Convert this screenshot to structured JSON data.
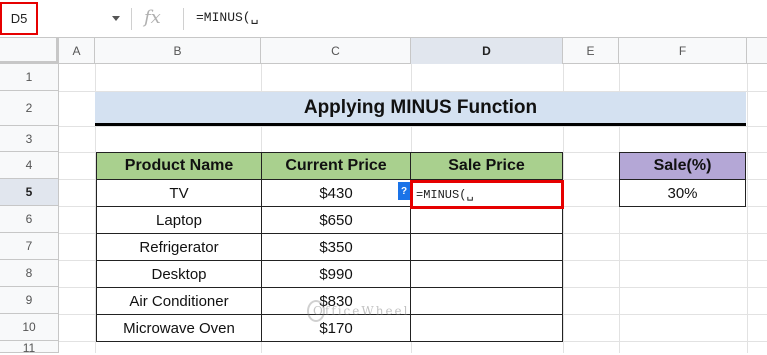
{
  "formula_bar": {
    "name_box": "D5",
    "fx_label": "fx",
    "formula": "=MINUS(␣"
  },
  "columns": [
    "A",
    "B",
    "C",
    "D",
    "E",
    "F"
  ],
  "rows": [
    "1",
    "2",
    "3",
    "4",
    "5",
    "6",
    "7",
    "8",
    "9",
    "10",
    "11"
  ],
  "title": "Applying MINUS Function",
  "table": {
    "headers": [
      "Product Name",
      "Current Price",
      "Sale Price"
    ],
    "rows": [
      {
        "product": "TV",
        "price": "$430",
        "sale": "=MINUS(␣"
      },
      {
        "product": "Laptop",
        "price": "$650",
        "sale": ""
      },
      {
        "product": "Refrigerator",
        "price": "$350",
        "sale": ""
      },
      {
        "product": "Desktop",
        "price": "$990",
        "sale": ""
      },
      {
        "product": "Air Conditioner",
        "price": "$830",
        "sale": ""
      },
      {
        "product": "Microwave Oven",
        "price": "$170",
        "sale": ""
      }
    ]
  },
  "sale_percent": {
    "header": "Sale(%)",
    "value": "30%"
  },
  "help_badge": "?",
  "watermark": "OfficeWheel",
  "colors": {
    "header_green": "#a9d08e",
    "title_blue": "#d4e1f1",
    "sale_purple": "#b4a7d6",
    "highlight_red": "#e60000"
  }
}
